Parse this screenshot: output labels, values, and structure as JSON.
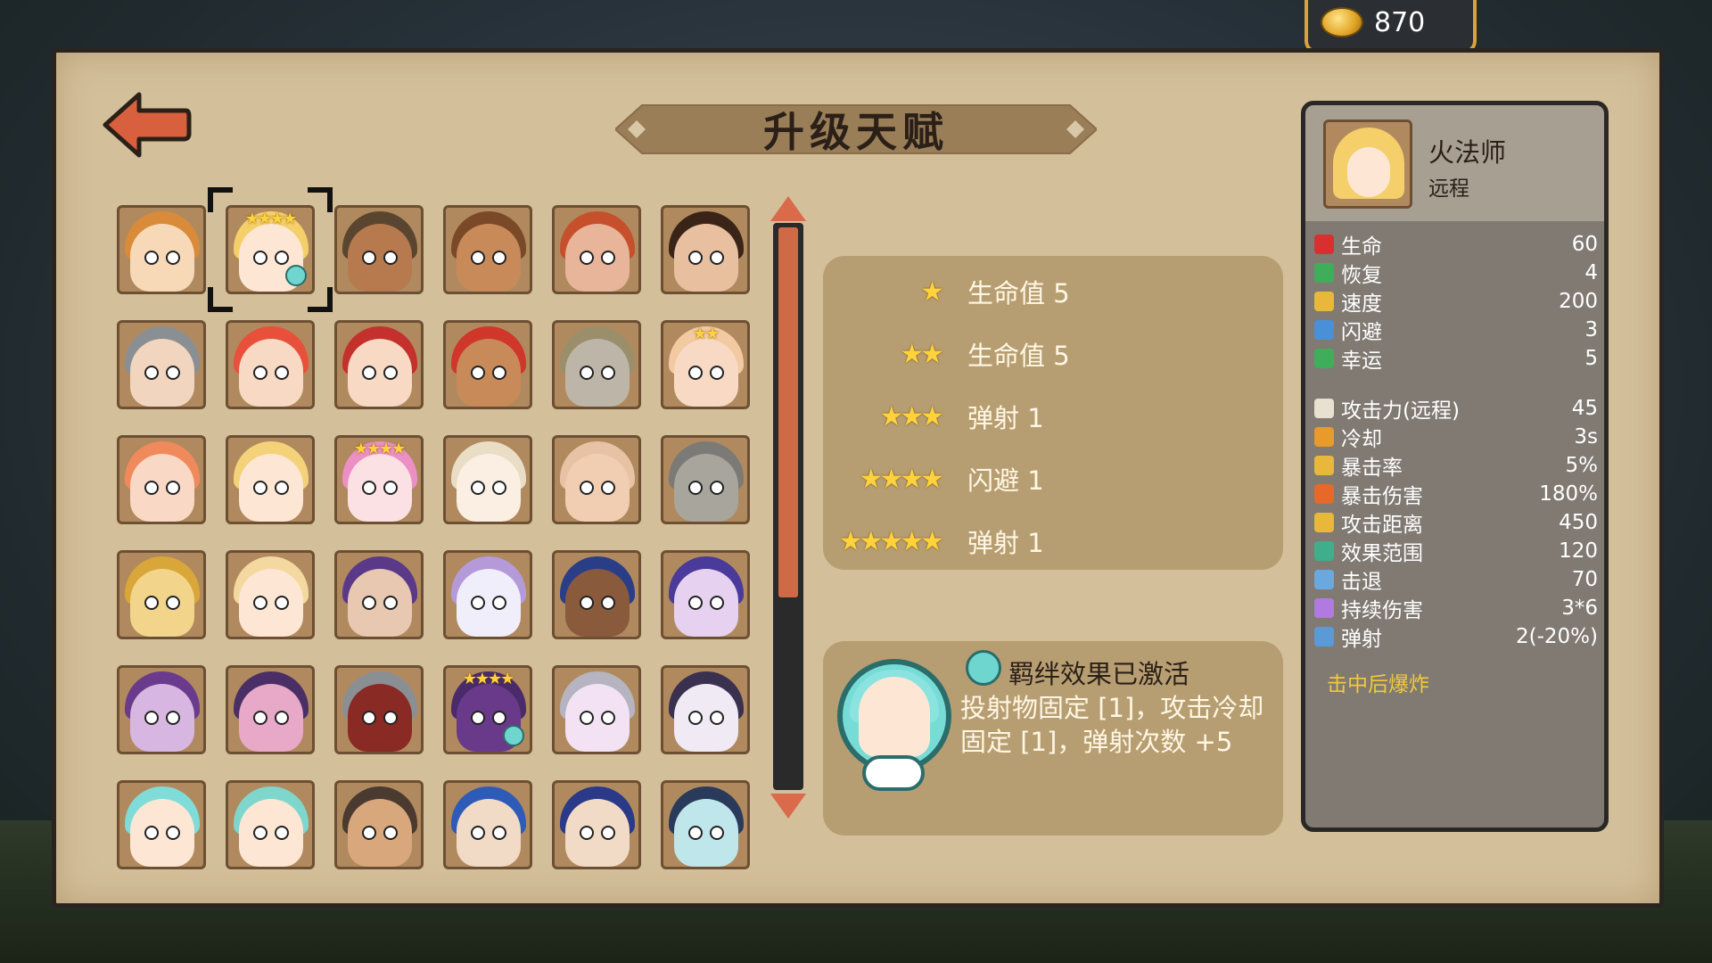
{
  "currency": {
    "coins": "870",
    "icon": "coin-icon"
  },
  "header": {
    "title": "升级天赋",
    "back_icon": "back-arrow-icon"
  },
  "heroes": {
    "rows": [
      [
        {
          "hair": "#d98b3a",
          "skin": "#f7d9b8",
          "stars": "",
          "badge": false
        },
        {
          "hair": "#f5cf6a",
          "skin": "#fde7d4",
          "stars": "★★★★",
          "badge": true
        },
        {
          "hair": "#5a4630",
          "skin": "#b67a4e",
          "stars": "",
          "badge": false
        },
        {
          "hair": "#7a4a28",
          "skin": "#c98a5a",
          "stars": "",
          "badge": false
        },
        {
          "hair": "#c6502c",
          "skin": "#e8b49a",
          "stars": "",
          "badge": false
        },
        {
          "hair": "#3a2418",
          "skin": "#e8c0a0",
          "stars": "",
          "badge": false
        }
      ],
      [
        {
          "hair": "#8a8f94",
          "skin": "#f1d5bf",
          "stars": "",
          "badge": false
        },
        {
          "hair": "#e8503c",
          "skin": "#f7d9c4",
          "stars": "",
          "badge": false
        },
        {
          "hair": "#c4302c",
          "skin": "#f7d9c4",
          "stars": "",
          "badge": false
        },
        {
          "hair": "#d0362a",
          "skin": "#c98a5a",
          "stars": "",
          "badge": false
        },
        {
          "hair": "#9a8f6a",
          "skin": "#bdb6a8",
          "stars": "",
          "badge": false
        },
        {
          "hair": "#f2c9a0",
          "skin": "#f7d9c4",
          "stars": "★★",
          "badge": false
        }
      ],
      [
        {
          "hair": "#f08a5c",
          "skin": "#f9d8c6",
          "stars": "",
          "badge": false
        },
        {
          "hair": "#f4d27a",
          "skin": "#fde7d4",
          "stars": "",
          "badge": false
        },
        {
          "hair": "#ec8fc4",
          "skin": "#fbe1e4",
          "stars": "★★★★",
          "badge": false
        },
        {
          "hair": "#e9ddc6",
          "skin": "#fbefe4",
          "stars": "",
          "badge": false
        },
        {
          "hair": "#e8c2a4",
          "skin": "#f1cdb2",
          "stars": "",
          "badge": false
        },
        {
          "hair": "#7b7a76",
          "skin": "#a8a59c",
          "stars": "",
          "badge": false
        }
      ],
      [
        {
          "hair": "#d9a63a",
          "skin": "#f2d58a",
          "stars": "",
          "badge": false
        },
        {
          "hair": "#f3d9a0",
          "skin": "#fde7d4",
          "stars": "",
          "badge": false
        },
        {
          "hair": "#5a3a88",
          "skin": "#e8c8b0",
          "stars": "",
          "badge": false
        },
        {
          "hair": "#b49ad8",
          "skin": "#f0eefa",
          "stars": "",
          "badge": false
        },
        {
          "hair": "#2a3e88",
          "skin": "#8a5a3c",
          "stars": "",
          "badge": false
        },
        {
          "hair": "#4a3a9a",
          "skin": "#e6d2f0",
          "stars": "",
          "badge": false
        }
      ],
      [
        {
          "hair": "#6a3a8c",
          "skin": "#d8b6e2",
          "stars": "",
          "badge": false
        },
        {
          "hair": "#4a2f66",
          "skin": "#e8a8c8",
          "stars": "",
          "badge": false
        },
        {
          "hair": "#8a8f94",
          "skin": "#8a2a24",
          "stars": "",
          "badge": false
        },
        {
          "hair": "#4a2a6a",
          "skin": "#6a3a8a",
          "stars": "★★★★",
          "badge": true
        },
        {
          "hair": "#b5b4c0",
          "skin": "#f2e2f4",
          "stars": "",
          "badge": false
        },
        {
          "hair": "#3a3050",
          "skin": "#f0eaf4",
          "stars": "",
          "badge": false
        }
      ],
      [
        {
          "hair": "#7fdcd8",
          "skin": "#fde7d4",
          "stars": "",
          "badge": false
        },
        {
          "hair": "#7fd6cc",
          "skin": "#fde7d4",
          "stars": "",
          "badge": false
        },
        {
          "hair": "#4a3a30",
          "skin": "#d9a77c",
          "stars": "",
          "badge": false
        },
        {
          "hair": "#2f5bb8",
          "skin": "#f1dac6",
          "stars": "",
          "badge": false
        },
        {
          "hair": "#2a3a88",
          "skin": "#f1dac6",
          "stars": "",
          "badge": false
        },
        {
          "hair": "#2a3a5a",
          "skin": "#bfe6ea",
          "stars": "",
          "badge": false
        }
      ]
    ]
  },
  "talents": [
    {
      "stars": "★",
      "label": "生命值 5"
    },
    {
      "stars": "★★",
      "label": "生命值 5"
    },
    {
      "stars": "★★★",
      "label": "弹射 1"
    },
    {
      "stars": "★★★★",
      "label": "闪避 1"
    },
    {
      "stars": "★★★★★",
      "label": "弹射 1"
    }
  ],
  "bond": {
    "title": "羁绊效果已激活",
    "description": "投射物固定 [1]，攻击冷却固定 [1]，弹射次数 +5",
    "icon": "handshake-icon"
  },
  "hero_detail": {
    "name": "火法师",
    "type": "远程",
    "stats_basic": [
      {
        "label": "生命",
        "value": "60",
        "icon": "heart-icon",
        "color": "#d83030"
      },
      {
        "label": "恢复",
        "value": "4",
        "icon": "plus-icon",
        "color": "#3fae5a"
      },
      {
        "label": "速度",
        "value": "200",
        "icon": "boot-icon",
        "color": "#e8b83a"
      },
      {
        "label": "闪避",
        "value": "3",
        "icon": "dodge-icon",
        "color": "#4a90d8"
      },
      {
        "label": "幸运",
        "value": "5",
        "icon": "clover-icon",
        "color": "#3fae5a"
      }
    ],
    "stats_combat": [
      {
        "label": "攻击力(远程)",
        "value": "45",
        "icon": "sword-icon",
        "color": "#e8e0d0"
      },
      {
        "label": "冷却",
        "value": "3s",
        "icon": "clock-icon",
        "color": "#e89a2a"
      },
      {
        "label": "暴击率",
        "value": "5%",
        "icon": "crit-icon",
        "color": "#e8b83a"
      },
      {
        "label": "暴击伤害",
        "value": "180%",
        "icon": "burst-icon",
        "color": "#e8682a"
      },
      {
        "label": "攻击距离",
        "value": "450",
        "icon": "range-icon",
        "color": "#e8b83a"
      },
      {
        "label": "效果范围",
        "value": "120",
        "icon": "area-icon",
        "color": "#3fae8a"
      },
      {
        "label": "击退",
        "value": "70",
        "icon": "knockback-icon",
        "color": "#6aa8e0"
      },
      {
        "label": "持续伤害",
        "value": "3*6",
        "icon": "poison-icon",
        "color": "#b07ae0"
      },
      {
        "label": "弹射",
        "value": "2(-20%)",
        "icon": "bounce-icon",
        "color": "#5a9ad8"
      }
    ],
    "extra": "击中后爆炸"
  }
}
